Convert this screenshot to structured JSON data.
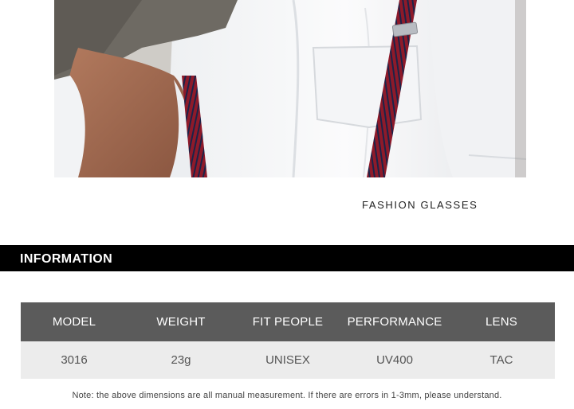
{
  "caption": "FASHION GLASSES",
  "info_heading": "INFORMATION",
  "spec_table": {
    "headers": [
      "MODEL",
      "WEIGHT",
      "FIT PEOPLE",
      "PERFORMANCE",
      "LENS"
    ],
    "row": [
      "3016",
      "23g",
      "UNISEX",
      "UV400",
      "TAC"
    ]
  },
  "note": "Note: the above dimensions are all manual measurement. If there are errors in 1-3mm, please understand.",
  "colors": {
    "heading_bar": "#000000",
    "table_header": "#5b5b5b",
    "table_row": "#ececec",
    "suspender_red": "#8e1a2a",
    "suspender_navy": "#1c2348"
  }
}
